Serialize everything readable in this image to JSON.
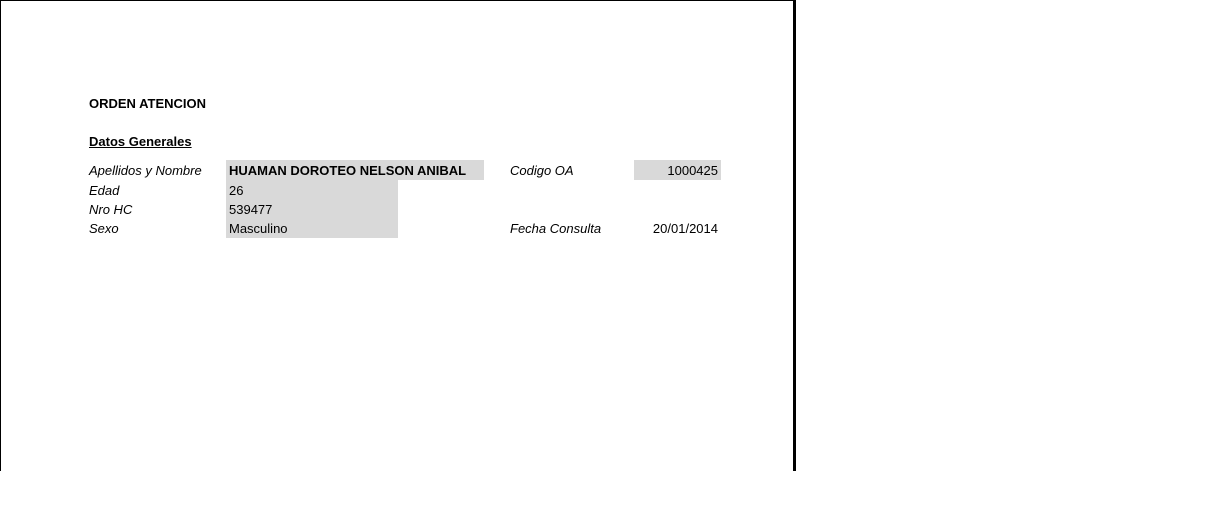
{
  "document": {
    "title": "ORDEN ATENCION",
    "section_title": "Datos Generales",
    "fields": {
      "nombre": {
        "label": "Apellidos y Nombre",
        "value": "HUAMAN DOROTEO NELSON ANIBAL"
      },
      "edad": {
        "label": "Edad",
        "value": "26"
      },
      "nro_hc": {
        "label": "Nro HC",
        "value": "539477"
      },
      "sexo": {
        "label": "Sexo",
        "value": "Masculino"
      },
      "codigo_oa": {
        "label": "Codigo OA",
        "value": "1000425"
      },
      "fecha_consulta": {
        "label": "Fecha Consulta",
        "value": "20/01/2014"
      }
    },
    "colors": {
      "field_fill": "#d9d9d9",
      "page_border": "#000000"
    }
  }
}
